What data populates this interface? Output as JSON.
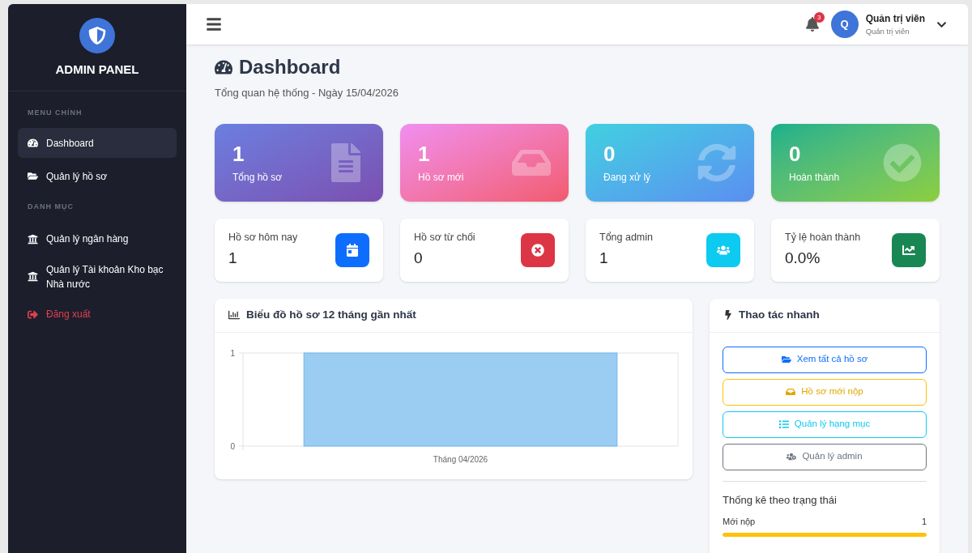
{
  "sidebar": {
    "brand": "ADMIN PANEL",
    "sections": [
      {
        "heading": "MENU CHÍNH",
        "items": [
          {
            "label": "Dashboard",
            "kind": "gauge",
            "selected": true
          },
          {
            "label": "Quản lý hồ sơ",
            "kind": "folder",
            "selected": false
          }
        ]
      },
      {
        "heading": "DANH MỤC",
        "items": [
          {
            "label": "Quản lý ngân hàng",
            "kind": "bank",
            "selected": false
          },
          {
            "label": "Quản lý Tài khoản Kho bạc Nhà nước",
            "kind": "bank",
            "selected": false
          },
          {
            "label": "Đăng xuất",
            "kind": "logout",
            "selected": false
          }
        ]
      }
    ]
  },
  "topbar": {
    "notification_count": "3",
    "avatar_letter": "Q",
    "user_name": "Quản trị viên",
    "user_role": "Quản trị viên"
  },
  "page": {
    "title": "Dashboard",
    "subtitle": "Tổng quan hệ thống - Ngày 15/04/2026"
  },
  "stat_cards": [
    {
      "value": "1",
      "label": "Tổng hồ sơ",
      "kind": "purple"
    },
    {
      "value": "1",
      "label": "Hồ sơ mới",
      "kind": "pink"
    },
    {
      "value": "0",
      "label": "Đang xử lý",
      "kind": "cyan"
    },
    {
      "value": "0",
      "label": "Hoàn thành",
      "kind": "green"
    }
  ],
  "info_cards": [
    {
      "label": "Hồ sơ hôm nay",
      "value": "1",
      "kind": "calendar"
    },
    {
      "label": "Hồ sơ từ chối",
      "value": "0",
      "kind": "rejected"
    },
    {
      "label": "Tổng admin",
      "value": "1",
      "kind": "users"
    },
    {
      "label": "Tỷ lệ hoàn thành",
      "value": "0.0%",
      "kind": "chart"
    }
  ],
  "chart_card": {
    "title": "Biểu đồ hồ sơ 12 tháng gần nhất",
    "chart_data": {
      "type": "bar",
      "categories": [
        "Tháng 04/2026"
      ],
      "series": [
        {
          "color": "#9bcdf3",
          "values": [
            1
          ]
        }
      ],
      "ylim": [
        0,
        1
      ],
      "yticks": [
        0,
        1
      ]
    }
  },
  "quick_actions": {
    "title": "Thao tác nhanh",
    "buttons": [
      {
        "label": "Xem tất cả hồ sơ",
        "kind": "primary"
      },
      {
        "label": "Hồ sơ mới nộp",
        "kind": "warning"
      },
      {
        "label": "Quản lý hạng mục",
        "kind": "info"
      },
      {
        "label": "Quản lý admin",
        "kind": "secondary"
      }
    ],
    "status_title": "Thống kê theo trạng thái",
    "statuses": [
      {
        "label": "Mới nộp",
        "count": "1",
        "level": 1,
        "color": "#ffc107"
      }
    ]
  }
}
